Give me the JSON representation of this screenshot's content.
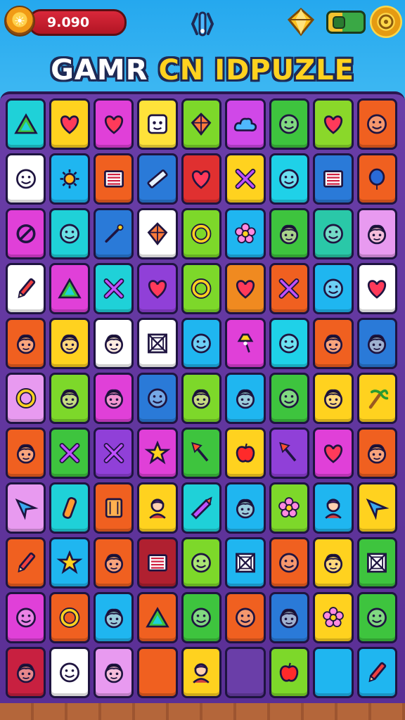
{
  "hud": {
    "score": "9.090",
    "sun_icon": "sun-badge-icon",
    "tune_icon": "tuning-fork-icon",
    "gem_icon": "gem-icon",
    "toggle_icon": "toggle-icon",
    "coin_icon": "coin-icon"
  },
  "title": {
    "part1": "GAMR",
    "part2": "CN IDPUZLE"
  },
  "colors": {
    "sky": "#2aa7ea",
    "board": "#6a3ea8",
    "tile_border": "#1e1440"
  },
  "tiles": [
    [
      "#1fd1d8",
      "triangle"
    ],
    [
      "#ffd21f",
      "heart"
    ],
    [
      "#e040d8",
      "heart"
    ],
    [
      "#ffe23a",
      "robot-face"
    ],
    [
      "#7dd82a",
      "kite"
    ],
    [
      "#d048e8",
      "cloud"
    ],
    [
      "#3ec43e",
      "smiley"
    ],
    [
      "#8ad82a",
      "heart"
    ],
    [
      "#f06020",
      "smiley"
    ],
    [
      "#ffffff",
      "smiley"
    ],
    [
      "#1fb6f0",
      "sun"
    ],
    [
      "#f06020",
      "flag"
    ],
    [
      "#2a7ad8",
      "ruler"
    ],
    [
      "#e03030",
      "heart"
    ],
    [
      "#ffd21f",
      "cross"
    ],
    [
      "#1fd1e8",
      "smiley"
    ],
    [
      "#2a7ad8",
      "flag"
    ],
    [
      "#f06020",
      "balloon"
    ],
    [
      "#e040d8",
      "forbidden"
    ],
    [
      "#1fd1d8",
      "smiley"
    ],
    [
      "#2a7ad8",
      "wand"
    ],
    [
      "#ffffff",
      "kite"
    ],
    [
      "#7dd82a",
      "ring"
    ],
    [
      "#1fb6f0",
      "flower"
    ],
    [
      "#3ec43e",
      "face"
    ],
    [
      "#2ac8a8",
      "smiley"
    ],
    [
      "#e89af0",
      "face"
    ],
    [
      "#ffffff",
      "pencil"
    ],
    [
      "#e040d8",
      "triangle"
    ],
    [
      "#1fd1d8",
      "cross"
    ],
    [
      "#9040d8",
      "heart"
    ],
    [
      "#7dd82a",
      "ring"
    ],
    [
      "#f08a20",
      "heart"
    ],
    [
      "#f06020",
      "cross"
    ],
    [
      "#1fb6f0",
      "smiley"
    ],
    [
      "#ffffff",
      "heart"
    ],
    [
      "#f06020",
      "face"
    ],
    [
      "#ffd21f",
      "face"
    ],
    [
      "#ffffff",
      "face"
    ],
    [
      "#ffffff",
      "box"
    ],
    [
      "#1fb6f0",
      "smiley"
    ],
    [
      "#e040d8",
      "lamp"
    ],
    [
      "#1fd1e8",
      "smiley"
    ],
    [
      "#f06020",
      "face"
    ],
    [
      "#2a7ad8",
      "face"
    ],
    [
      "#e89af0",
      "ring"
    ],
    [
      "#7dd82a",
      "face"
    ],
    [
      "#e040d8",
      "face"
    ],
    [
      "#2a7ad8",
      "smiley"
    ],
    [
      "#7dd82a",
      "face"
    ],
    [
      "#1fb6f0",
      "face"
    ],
    [
      "#3ec43e",
      "smiley"
    ],
    [
      "#ffd21f",
      "face"
    ],
    [
      "#ffd21f",
      "palm"
    ],
    [
      "#f06020",
      "face"
    ],
    [
      "#3ec43e",
      "cross"
    ],
    [
      "#9040d8",
      "cross"
    ],
    [
      "#e040d8",
      "star"
    ],
    [
      "#3ec43e",
      "pin"
    ],
    [
      "#ffd21f",
      "apple"
    ],
    [
      "#9040d8",
      "pin"
    ],
    [
      "#e040d8",
      "heart"
    ],
    [
      "#f06020",
      "face"
    ],
    [
      "#e89af0",
      "arrow"
    ],
    [
      "#1fd1d8",
      "bottle"
    ],
    [
      "#f06020",
      "scroll"
    ],
    [
      "#ffd21f",
      "person"
    ],
    [
      "#1fd1d8",
      "rocket"
    ],
    [
      "#1fb6f0",
      "face"
    ],
    [
      "#7dd82a",
      "flower"
    ],
    [
      "#1fb6f0",
      "person"
    ],
    [
      "#ffd21f",
      "arrow"
    ],
    [
      "#f06020",
      "pencil"
    ],
    [
      "#1fb6f0",
      "star"
    ],
    [
      "#f06020",
      "face"
    ],
    [
      "#b02030",
      "flag"
    ],
    [
      "#7dd82a",
      "smiley"
    ],
    [
      "#1fb6f0",
      "box"
    ],
    [
      "#f06020",
      "smiley"
    ],
    [
      "#ffd21f",
      "face"
    ],
    [
      "#3ec43e",
      "box"
    ],
    [
      "#e040d8",
      "smiley"
    ],
    [
      "#f06020",
      "ring"
    ],
    [
      "#1fb6f0",
      "face"
    ],
    [
      "#f06020",
      "triangle"
    ],
    [
      "#3ec43e",
      "smiley"
    ],
    [
      "#f06020",
      "smiley"
    ],
    [
      "#2a7ad8",
      "face"
    ],
    [
      "#ffd21f",
      "flower"
    ],
    [
      "#3ec43e",
      "smiley"
    ],
    [
      "#c82040",
      "face"
    ],
    [
      "#ffffff",
      "smiley"
    ],
    [
      "#e89af0",
      "face"
    ],
    [
      "#f06020",
      "blank"
    ],
    [
      "#ffd21f",
      "person"
    ],
    [
      "#6a3ea8",
      "blank"
    ],
    [
      "#7dd82a",
      "apple"
    ],
    [
      "#1fb6f0",
      "blank"
    ],
    [
      "#1fb6f0",
      "pencil"
    ]
  ]
}
